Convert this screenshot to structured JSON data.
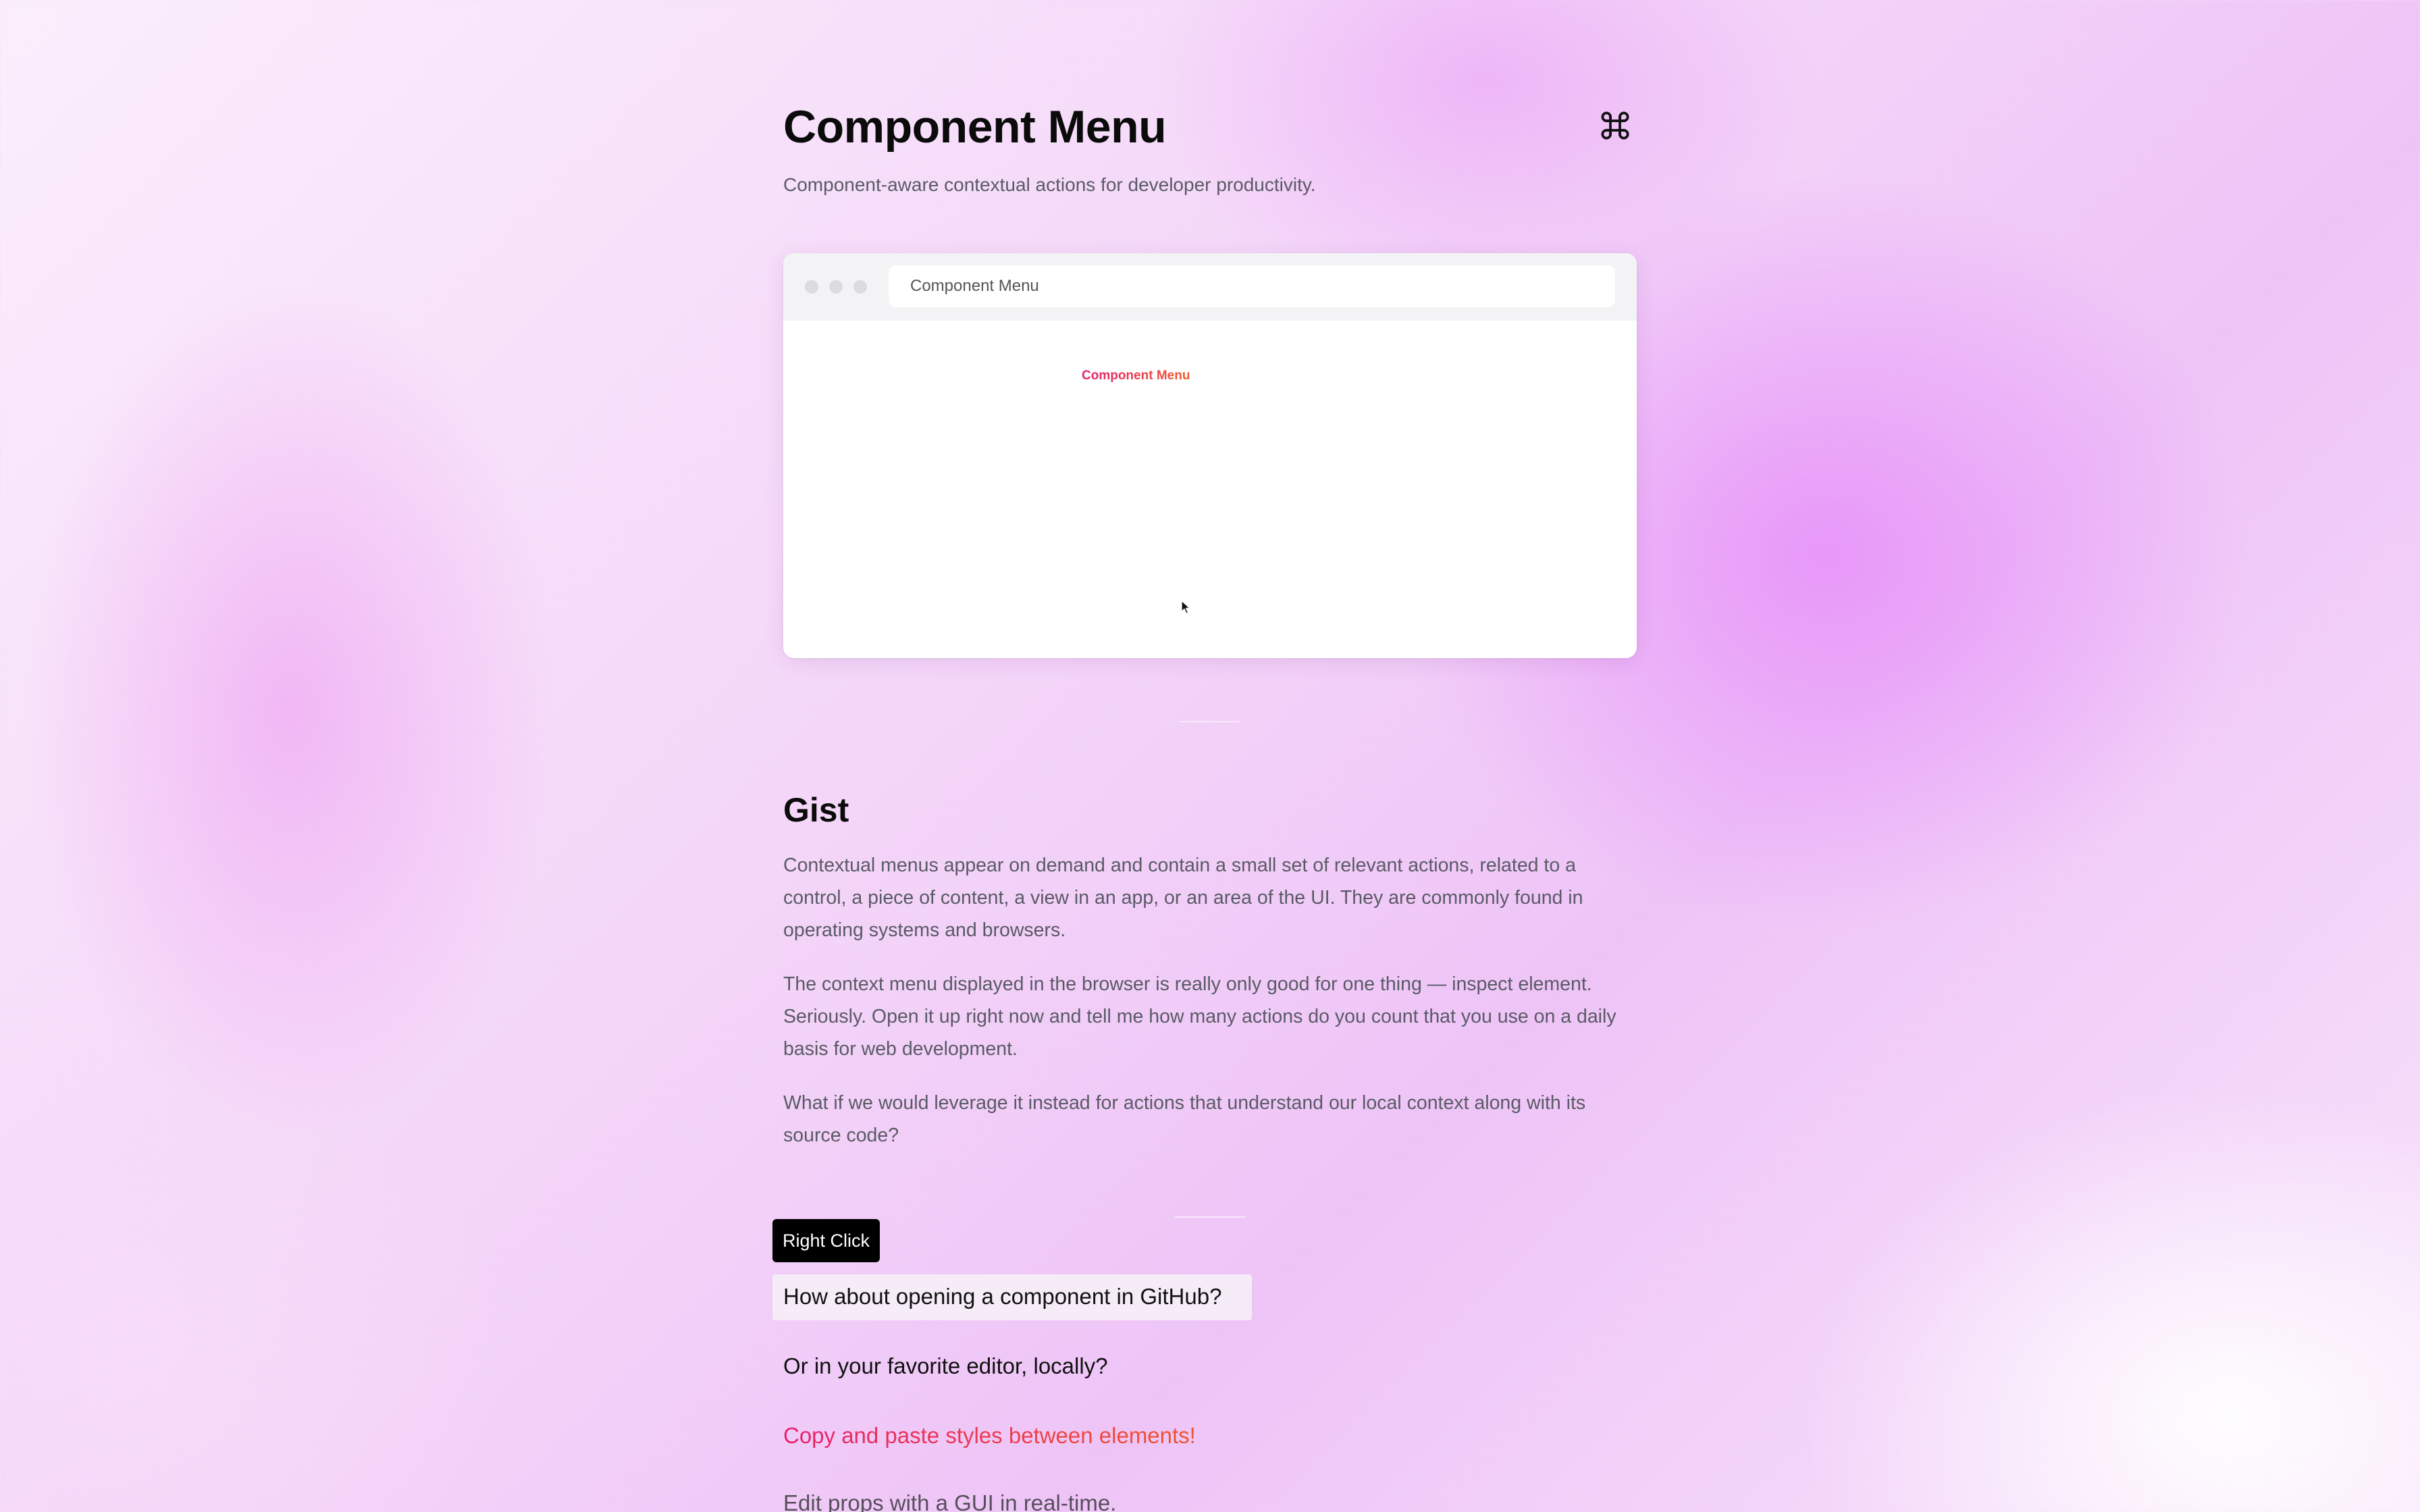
{
  "header": {
    "title": "Component Menu",
    "subtitle": "Component-aware contextual actions for developer productivity.",
    "shortcut_icon": "command-key-icon"
  },
  "demo": {
    "url": "Component Menu",
    "label": "Component Menu",
    "cursor_icon": "mouse-pointer-icon",
    "window_dots": [
      "close-dot",
      "minimize-dot",
      "maximize-dot"
    ]
  },
  "gist": {
    "heading": "Gist",
    "paragraphs": [
      "Contextual menus appear on demand and contain a small set of relevant actions, related to a control, a piece of content, a view in an app, or an area of the UI. They are commonly found in operating systems and browsers.",
      "The context menu displayed in the browser is really only good for one thing — inspect element. Seriously. Open it up right now and tell me how many actions do you count that you use on a daily basis for web development.",
      "What if we would leverage it instead for actions that understand our local context along with its source code?"
    ]
  },
  "features": {
    "tag": "Right Click",
    "items": [
      "How about opening a component in GitHub?",
      "Or in your favorite editor, locally?",
      "Copy and paste styles between elements!",
      "Edit props with a GUI in real-time."
    ]
  },
  "colors": {
    "accent_start": "#e8206e",
    "accent_end": "#f0552e",
    "text_muted": "#5a5a66",
    "tag_background": "#000000"
  }
}
